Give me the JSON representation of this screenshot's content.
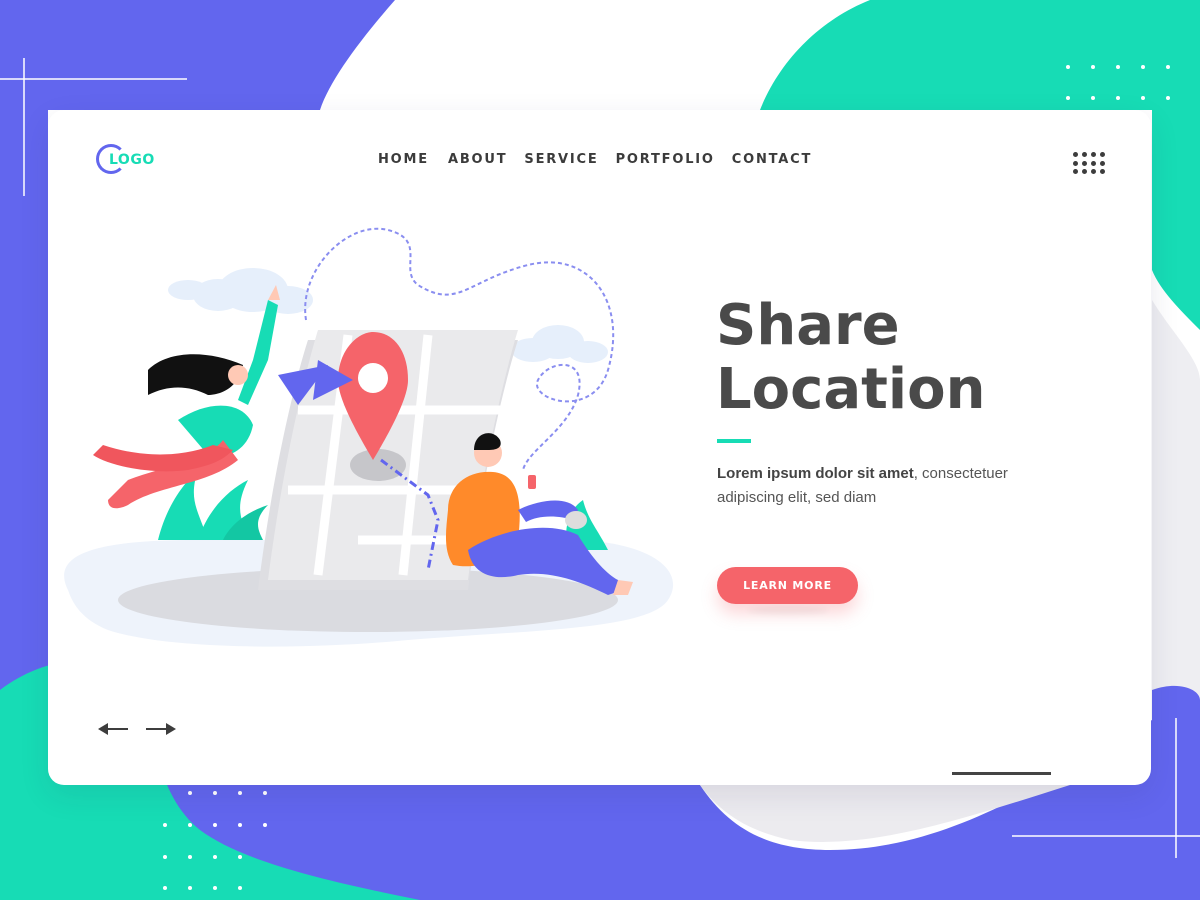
{
  "logo": {
    "text": "LOGO"
  },
  "nav": {
    "items": [
      "HOME",
      "ABOUT",
      "SERVICE",
      "PORTFOLIO",
      "CONTACT"
    ]
  },
  "icons": {
    "menu": "grid-menu-icon",
    "prev": "arrow-left-icon",
    "next": "arrow-right-icon"
  },
  "hero": {
    "title_line1": "Share",
    "title_line2": "Location",
    "desc_strong": "Lorem ipsum dolor sit amet",
    "desc_rest": ", consectetuer adipiscing elit, sed diam",
    "cta": "LEARN MORE"
  },
  "colors": {
    "purple": "#6266ee",
    "teal": "#17dcb5",
    "coral": "#f5646a",
    "title": "#4a4a4a"
  }
}
